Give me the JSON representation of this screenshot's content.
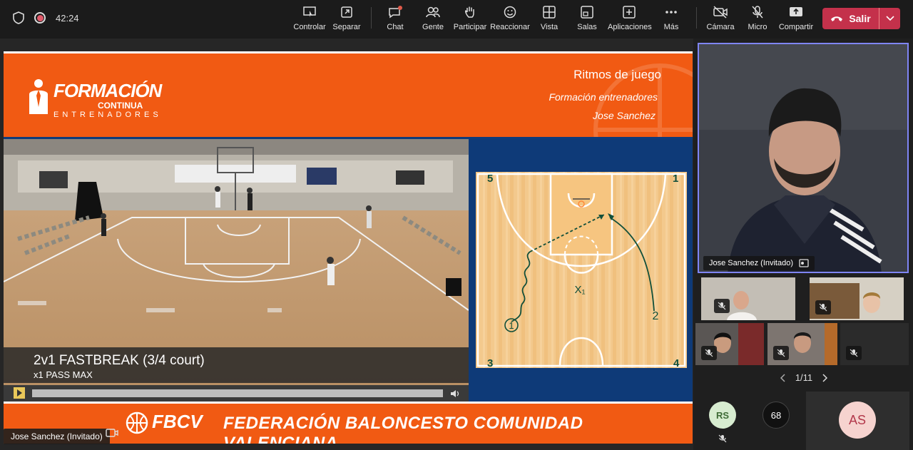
{
  "top": {
    "timer": "42:24",
    "buttons": [
      {
        "label": "Controlar",
        "icon": "control-icon"
      },
      {
        "label": "Separar",
        "icon": "popout-icon"
      },
      {
        "label": "Chat",
        "icon": "chat-icon"
      },
      {
        "label": "Gente",
        "icon": "people-icon"
      },
      {
        "label": "Participar",
        "icon": "raise-hand-icon"
      },
      {
        "label": "Reaccionar",
        "icon": "smile-icon"
      },
      {
        "label": "Vista",
        "icon": "view-icon"
      },
      {
        "label": "Salas",
        "icon": "rooms-icon"
      },
      {
        "label": "Aplicaciones",
        "icon": "apps-icon"
      },
      {
        "label": "Más",
        "icon": "more-icon"
      },
      {
        "label": "Cámara",
        "icon": "camera-off-icon"
      },
      {
        "label": "Micro",
        "icon": "mic-off-icon"
      },
      {
        "label": "Compartir",
        "icon": "share-icon"
      }
    ],
    "leave_label": "Salir",
    "leave_color": "#c4314b"
  },
  "slide": {
    "logo_title": "FORMACIÓN",
    "logo_sub": "CONTINUA",
    "logo_sub2": "ENTRENADORES",
    "title": "Ritmos de juego",
    "subtitle": "Formación entrenadores",
    "author": "Jose Sanchez",
    "video_title": "2v1 FASTBREAK (3/4 court)",
    "video_subtitle": "x1 PASS MAX",
    "court_labels": {
      "corner_tl": "5",
      "corner_tr": "1",
      "corner_bl": "3",
      "corner_br": "4",
      "player1": "1",
      "player2": "2",
      "defender": "X₁"
    },
    "footer_logo": "FBCV",
    "footer_text": "FEDERACIÓN BALONCESTO COMUNIDAD VALENCIANA",
    "accent": "#f15a13",
    "navy": "#0e3a78"
  },
  "presenter_tag": "Jose Sanchez (Invitado)",
  "main_cam_name": "Jose Sanchez (Invitado)",
  "pager": {
    "text": "1/11"
  },
  "participants": {
    "rs": "RS",
    "count": "68",
    "as": "AS"
  }
}
